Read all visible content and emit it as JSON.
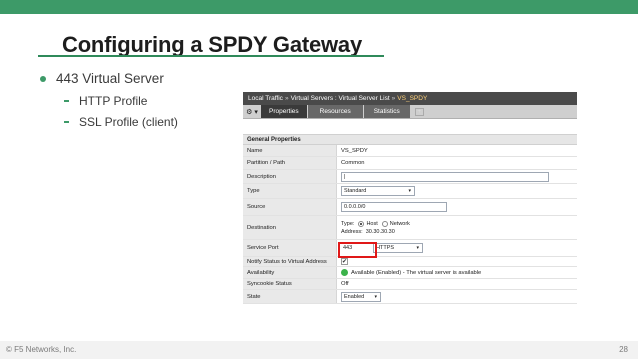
{
  "slide": {
    "title": "Configuring a SPDY Gateway",
    "bullet": "443 Virtual Server",
    "sub_bullets": [
      "HTTP Profile",
      "SSL Profile (client)"
    ],
    "copyright": "© F5 Networks, Inc.",
    "page_number": "28",
    "accent_color": "#3d9a68"
  },
  "screenshot": {
    "breadcrumb": {
      "part1": "Local Traffic",
      "part2": "Virtual Servers : Virtual Server List",
      "current": "VS_SPDY",
      "separator": "»"
    },
    "tabs": {
      "gear_icon": "⚙ ▾",
      "properties": "Properties",
      "resources": "Resources",
      "statistics": "Statistics",
      "plus_icon": "+"
    },
    "section_header": "General Properties",
    "rows": {
      "name": {
        "label": "Name",
        "value": "VS_SPDY"
      },
      "partition": {
        "label": "Partition / Path",
        "value": "Common"
      },
      "description": {
        "label": "Description",
        "value": "|"
      },
      "type": {
        "label": "Type",
        "value": "Standard",
        "arrow": "▾"
      },
      "source": {
        "label": "Source",
        "value": "0.0.0.0/0"
      },
      "destination": {
        "label": "Destination",
        "type_label": "Type:",
        "host_label": "Host",
        "network_label": "Network",
        "address_label": "Address:",
        "address_value": "30.30.30.30"
      },
      "service_port": {
        "label": "Service Port",
        "port": "443",
        "protocol": "HTTPS",
        "arrow": "▾"
      },
      "notify": {
        "label": "Notify Status to Virtual Address",
        "check": "✔"
      },
      "availability": {
        "label": "Availability",
        "value": "Available (Enabled) - The virtual server is available"
      },
      "syncookie": {
        "label": "Syncookie Status",
        "value": "Off"
      },
      "state": {
        "label": "State",
        "value": "Enabled",
        "arrow": "▾"
      }
    }
  }
}
